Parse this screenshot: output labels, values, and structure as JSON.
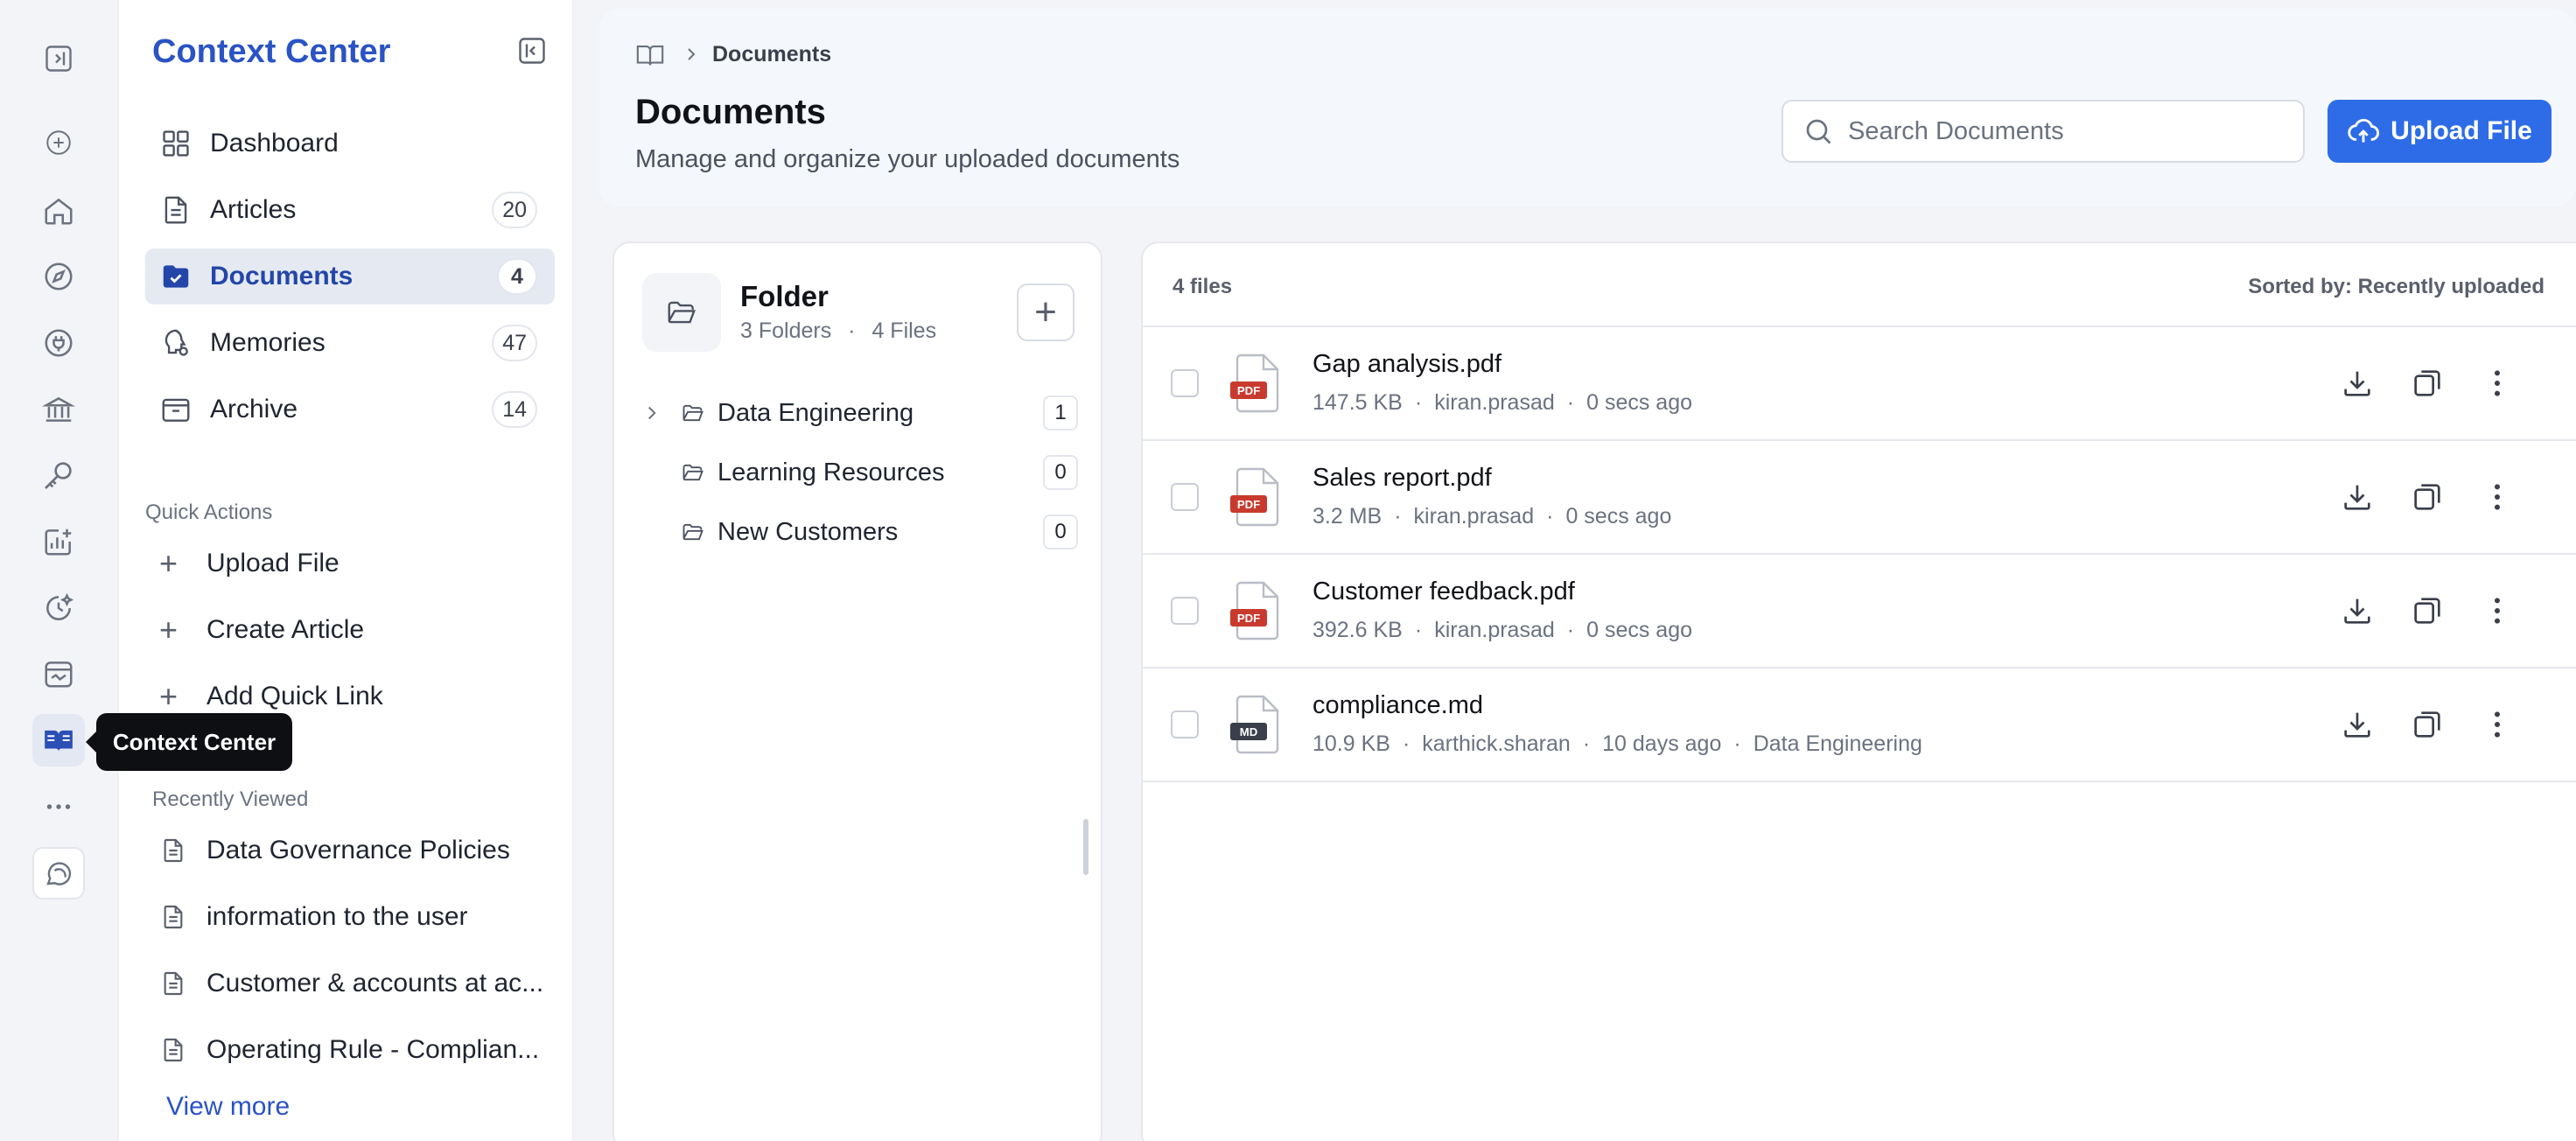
{
  "rail": {
    "tooltip": "Context Center",
    "icons": [
      "sidebar-toggle-icon",
      "plus-icon",
      "home-icon",
      "compass-icon",
      "plug-icon",
      "bank-icon",
      "key-icon",
      "chart-icon",
      "timer-icon",
      "calendar-icon",
      "book-icon",
      "more-icon",
      "chat-icon"
    ]
  },
  "panel": {
    "title": "Context Center",
    "nav": [
      {
        "label": "Dashboard",
        "count": null
      },
      {
        "label": "Articles",
        "count": "20"
      },
      {
        "label": "Documents",
        "count": "4"
      },
      {
        "label": "Memories",
        "count": "47"
      },
      {
        "label": "Archive",
        "count": "14"
      }
    ],
    "quick_actions_label": "Quick Actions",
    "quick_actions": [
      "Upload File",
      "Create Article",
      "Add Quick Link"
    ],
    "recently_viewed_label": "Recently Viewed",
    "recently_viewed": [
      "Data Governance Policies",
      "information to the user",
      "Customer & accounts at ac...",
      "Operating Rule - Complian..."
    ],
    "view_more": "View more"
  },
  "header": {
    "breadcrumb": "Documents",
    "title": "Documents",
    "subtitle": "Manage and organize your uploaded documents",
    "search_placeholder": "Search Documents",
    "upload_label": "Upload File"
  },
  "folders": {
    "title": "Folder",
    "folders_count": "3 Folders",
    "files_count": "4 Files",
    "items": [
      {
        "name": "Data Engineering",
        "count": "1"
      },
      {
        "name": "Learning Resources",
        "count": "0"
      },
      {
        "name": "New Customers",
        "count": "0"
      }
    ]
  },
  "files": {
    "count_label": "4 files",
    "sort_label": "Sorted by: Recently uploaded",
    "rows": [
      {
        "name": "Gap analysis.pdf",
        "type": "PDF",
        "size": "147.5 KB",
        "owner": "kiran.prasad",
        "time": "0 secs ago",
        "folder": ""
      },
      {
        "name": "Sales report.pdf",
        "type": "PDF",
        "size": "3.2 MB",
        "owner": "kiran.prasad",
        "time": "0 secs ago",
        "folder": ""
      },
      {
        "name": "Customer feedback.pdf",
        "type": "PDF",
        "size": "392.6 KB",
        "owner": "kiran.prasad",
        "time": "0 secs ago",
        "folder": ""
      },
      {
        "name": "compliance.md",
        "type": "MD",
        "size": "10.9 KB",
        "owner": "karthick.sharan",
        "time": "10 days ago",
        "folder": "Data Engineering"
      }
    ]
  },
  "colors": {
    "accent": "#2d6ce6",
    "brand_text": "#2a53c4",
    "pdf_red": "#c93a2e",
    "md_dark": "#3a3f4b"
  }
}
